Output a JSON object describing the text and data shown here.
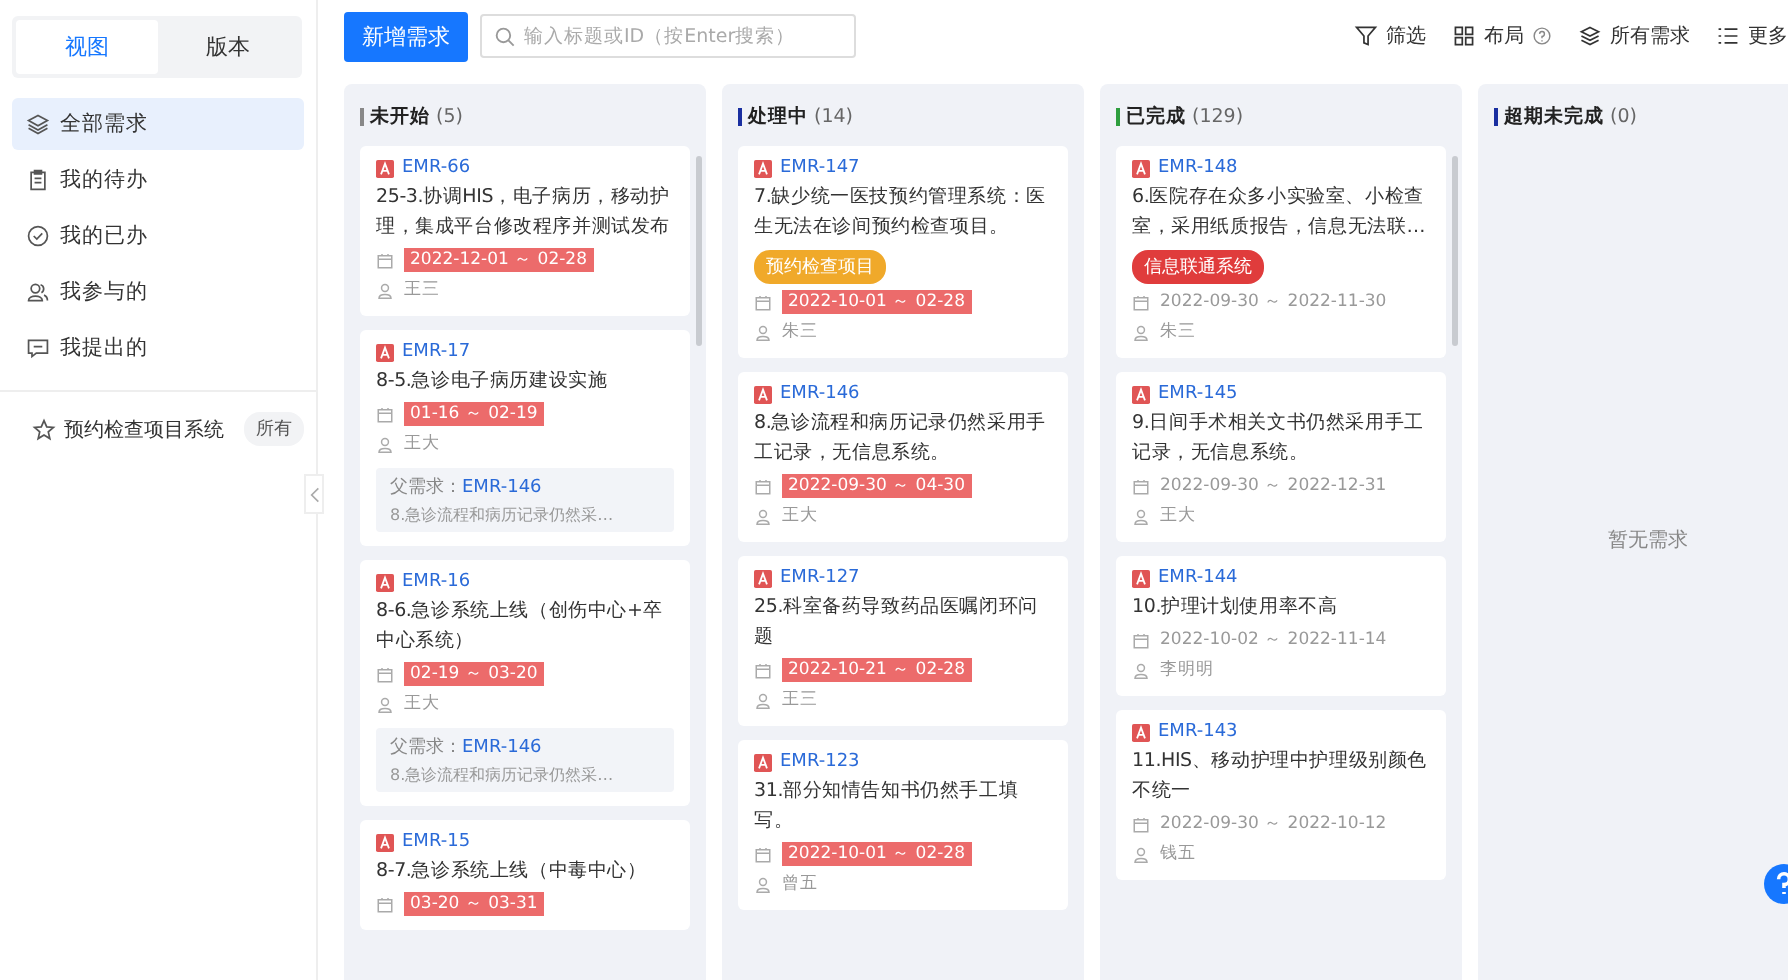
{
  "sidebar": {
    "tabs": [
      {
        "label": "视图",
        "selected": true
      },
      {
        "label": "版本",
        "selected": false
      }
    ],
    "items": [
      {
        "kind": "layers",
        "label": "全部需求",
        "selected": true
      },
      {
        "kind": "clipboard",
        "label": "我的待办",
        "selected": false
      },
      {
        "kind": "check",
        "label": "我的已办",
        "selected": false
      },
      {
        "kind": "people",
        "label": "我参与的",
        "selected": false
      },
      {
        "kind": "message",
        "label": "我提出的",
        "selected": false
      }
    ],
    "project": {
      "label": "预约检查项目系统",
      "badge": "所有"
    }
  },
  "toolbar": {
    "new_button": "新增需求",
    "search": {
      "placeholder": "输入标题或ID（按Enter搜索）"
    },
    "actions": [
      {
        "kind": "filter",
        "label": "筛选",
        "help": false
      },
      {
        "kind": "grid",
        "label": "布局",
        "help": true
      },
      {
        "kind": "layers",
        "label": "所有需求",
        "help": false
      },
      {
        "kind": "list",
        "label": "更多",
        "help": false
      }
    ]
  },
  "columns": [
    {
      "name": "未开始",
      "count": "(5)",
      "color": "#888888",
      "cards": [
        {
          "id": "EMR-66",
          "title": "25-3.协调HIS，电子病历，移动护理，集成平台修改程序并测试发布",
          "date": "2022-12-01 ～ 02-28",
          "overdue": true,
          "assignee": "王三"
        },
        {
          "id": "EMR-17",
          "title": "8-5.急诊电子病历建设实施",
          "date": "01-16 ～ 02-19",
          "overdue": true,
          "assignee": "王大",
          "parent": {
            "label": "父需求：",
            "id": "EMR-146",
            "title": "8.急诊流程和病历记录仍然采…"
          }
        },
        {
          "id": "EMR-16",
          "title": "8-6.急诊系统上线（创伤中心+卒中心系统）",
          "date": "02-19 ～ 03-20",
          "overdue": true,
          "assignee": "王大",
          "parent": {
            "label": "父需求：",
            "id": "EMR-146",
            "title": "8.急诊流程和病历记录仍然采…"
          }
        },
        {
          "id": "EMR-15",
          "title": "8-7.急诊系统上线（中毒中心）",
          "date": "03-20 ～ 03-31",
          "overdue": true
        }
      ]
    },
    {
      "name": "处理中",
      "count": "(14)",
      "color": "#1a2fa0",
      "cards": [
        {
          "id": "EMR-147",
          "title": "7.缺少统一医技预约管理系统：医生无法在诊间预约检查项目。",
          "tag": {
            "label": "预约检查项目",
            "color": "#f0a92a"
          },
          "date": "2022-10-01 ～ 02-28",
          "overdue": true,
          "assignee": "朱三"
        },
        {
          "id": "EMR-146",
          "title": "8.急诊流程和病历记录仍然采用手工记录，无信息系统。",
          "date": "2022-09-30 ～ 04-30",
          "overdue": true,
          "assignee": "王大"
        },
        {
          "id": "EMR-127",
          "title": "25.科室备药导致药品医嘱闭环问题",
          "date": "2022-10-21 ～ 02-28",
          "overdue": true,
          "assignee": "王三"
        },
        {
          "id": "EMR-123",
          "title": "31.部分知情告知书仍然手工填写。",
          "date": "2022-10-01 ～ 02-28",
          "overdue": true,
          "assignee": "曾五"
        }
      ]
    },
    {
      "name": "已完成",
      "count": "(129)",
      "color": "#2e9e3e",
      "cards": [
        {
          "id": "EMR-148",
          "title": "6.医院存在众多小实验室、小检查室，采用纸质报告，信息无法联…",
          "tag": {
            "label": "信息联通系统",
            "color": "#e03c3c"
          },
          "date": "2022-09-30 ～ 2022-11-30",
          "overdue": false,
          "assignee": "朱三"
        },
        {
          "id": "EMR-145",
          "title": "9.日间手术相关文书仍然采用手工记录，无信息系统。",
          "date": "2022-09-30 ～ 2022-12-31",
          "overdue": false,
          "assignee": "王大"
        },
        {
          "id": "EMR-144",
          "title": "10.护理计划使用率不高",
          "date": "2022-10-02 ～ 2022-11-14",
          "overdue": false,
          "assignee": "李明明"
        },
        {
          "id": "EMR-143",
          "title": "11.HIS、移动护理中护理级别颜色不统一",
          "date": "2022-09-30 ～ 2022-10-12",
          "overdue": false,
          "assignee": "钱五"
        }
      ]
    },
    {
      "name": "超期未完成",
      "count": "(0)",
      "color": "#1a2fa0",
      "empty_text": "暂无需求"
    }
  ]
}
